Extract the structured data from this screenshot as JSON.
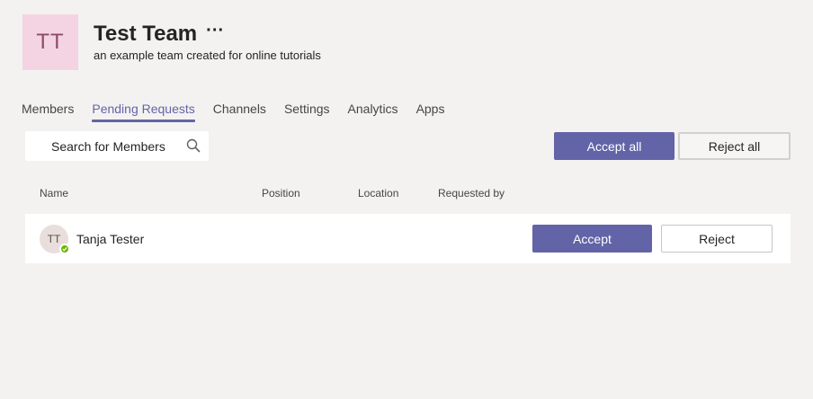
{
  "team": {
    "initials": "TT",
    "name": "Test Team",
    "more": "···",
    "description": "an example team created for online tutorials"
  },
  "tabs": [
    {
      "label": "Members"
    },
    {
      "label": "Pending Requests",
      "active": true
    },
    {
      "label": "Channels"
    },
    {
      "label": "Settings"
    },
    {
      "label": "Analytics"
    },
    {
      "label": "Apps"
    }
  ],
  "search": {
    "placeholder": "Search for Members"
  },
  "actions": {
    "accept_all": "Accept all",
    "reject_all": "Reject all"
  },
  "columns": {
    "name": "Name",
    "position": "Position",
    "location": "Location",
    "requested_by": "Requested by"
  },
  "requests": [
    {
      "initials": "TT",
      "name": "Tanja Tester",
      "status": "available",
      "accept_label": "Accept",
      "reject_label": "Reject"
    }
  ],
  "colors": {
    "accent": "#6264a7",
    "presence_available": "#6bb700",
    "team_avatar_bg": "#f4d4e3"
  }
}
